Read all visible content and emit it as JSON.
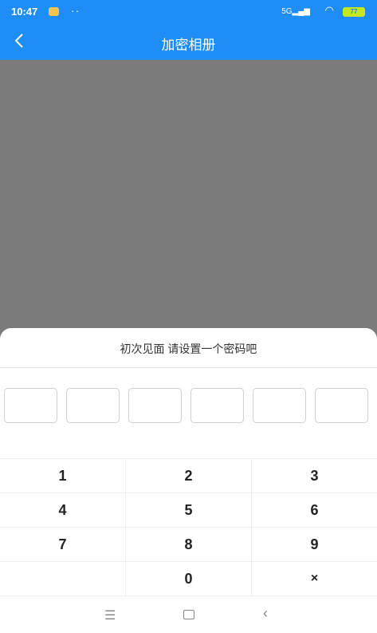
{
  "status": {
    "time": "10:47",
    "dots": "··",
    "signal": "5G",
    "battery": "77"
  },
  "header": {
    "title": "加密相册"
  },
  "panel": {
    "prompt": "初次见面 请设置一个密码吧",
    "pin_length": 6,
    "keys": [
      "1",
      "2",
      "3",
      "4",
      "5",
      "6",
      "7",
      "8",
      "9",
      "",
      "0",
      "×"
    ]
  },
  "colors": {
    "primary": "#1e8ef6",
    "overlay": "#7b7b7b",
    "battery": "#c5e81e"
  },
  "icons": {
    "back": "chevron-left-icon",
    "menu": "menu-icon",
    "home": "home-icon",
    "nav_back": "nav-back-icon"
  }
}
